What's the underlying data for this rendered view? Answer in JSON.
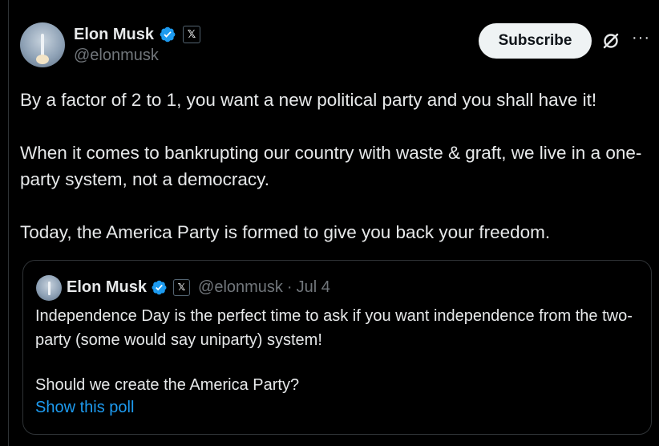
{
  "author": {
    "name": "Elon Musk",
    "handle": "@elonmusk"
  },
  "actions": {
    "subscribe_label": "Subscribe",
    "grok_icon": "grok-slash-circle-icon",
    "more_label": "···"
  },
  "post": {
    "paragraphs": [
      "By a factor of 2 to 1, you want a new political party and you shall have it!",
      "When it comes to bankrupting our country with waste & graft, we live in a one-party system, not a democracy.",
      "Today, the America Party is formed to give you back your freedom."
    ]
  },
  "quote": {
    "name": "Elon Musk",
    "handle": "@elonmusk",
    "separator": "·",
    "date": "Jul 4",
    "paragraphs": [
      "Independence Day is the perfect time to ask if you want independence from the two-party (some would say uniparty) system!",
      "Should we create the America Party?"
    ],
    "link_label": "Show this poll"
  },
  "badges": {
    "verified_color": "#1d9bf0",
    "affiliate_glyph": "𝕏"
  },
  "colors": {
    "background": "#000000",
    "text": "#e7e9ea",
    "secondary": "#71767b",
    "link": "#1d9bf0",
    "border": "#2f3336"
  }
}
